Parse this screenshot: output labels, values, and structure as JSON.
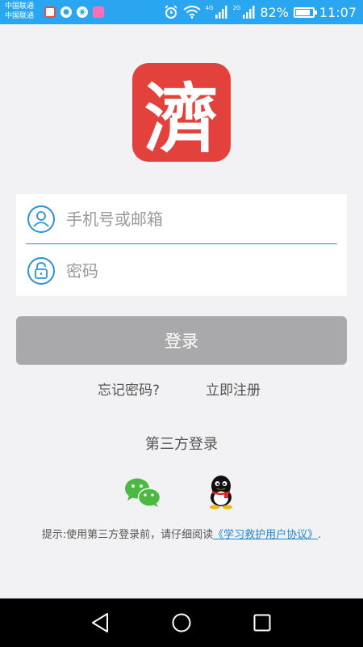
{
  "status_bar": {
    "carrier_1": "中国联通",
    "carrier_2": "中国联通",
    "signal_1": "4G",
    "signal_2": "2G",
    "battery": "82%",
    "time": "11:07"
  },
  "logo": {
    "char": "濟"
  },
  "login_form": {
    "phone_placeholder": "手机号或邮箱",
    "password_placeholder": "密码"
  },
  "login_button": "登录",
  "links": {
    "forgot_password": "忘记密码?",
    "register": "立即注册"
  },
  "third_party": {
    "title": "第三方登录",
    "providers": [
      "wechat",
      "qq"
    ]
  },
  "hint": {
    "prefix": "提示:使用第三方登录前，请仔细阅读",
    "agreement_link": "《学习救护用户协议》",
    "suffix": "."
  },
  "colors": {
    "status_bar": "#2aa5f0",
    "logo": "#e3413c",
    "accent": "#2b93d1",
    "login_button": "#a9a9ab"
  }
}
